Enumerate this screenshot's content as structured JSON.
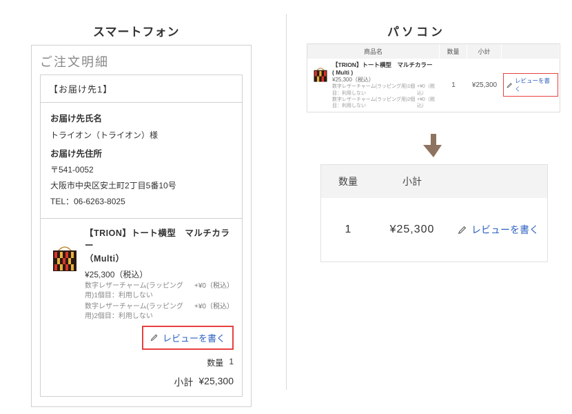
{
  "titles": {
    "smartphone": "スマートフォン",
    "pc": "パソコン"
  },
  "sp": {
    "panel_title": "ご注文明細",
    "dest_header": "【お届け先1】",
    "name_label": "お届け先氏名",
    "name_value": "トライオン（トライオン）様",
    "addr_label": "お届け先住所",
    "zip": "〒541-0052",
    "addr": "大阪市中央区安土町2丁目5番10号",
    "tel": "TEL：06-6263-8025",
    "product": {
      "name_l1": "【TRION】トート横型　マルチカラ",
      "name_l2": "ー",
      "color": "（Multi）",
      "price": "¥25,300（税込）",
      "opt1_l": "数字レザーチャーム(ラッピング用)1個目：利用しない",
      "opt1_r": "+¥0（税込）",
      "opt2_l": "数字レザーチャーム(ラッピング用)2個目：利用しない",
      "opt2_r": "+¥0（税込）"
    },
    "review_label": "レビューを書く",
    "qty_label": "数量",
    "qty_value": "1",
    "subtotal_label": "小計",
    "subtotal_value": "¥25,300"
  },
  "pc_mini": {
    "h1": "商品名",
    "h2": "数量",
    "h3": "小計",
    "name": "【TRION】トート横型　マルチカラー",
    "color": "( Multi )",
    "price": "¥25,300（税込）",
    "opt1_l": "数字レザーチャーム(ラッピング用)1個目：利用しない",
    "opt1_r": "+¥0（税込）",
    "opt2_l": "数字レザーチャーム(ラッピング用)2個目：利用しない",
    "opt2_r": "+¥0（税込）",
    "qty": "1",
    "subtotal": "¥25,300",
    "review_label": "レビューを書く"
  },
  "pc_big": {
    "h1": "数量",
    "h2": "小計",
    "qty": "1",
    "subtotal": "¥25,300",
    "review_label": "レビューを書く"
  }
}
